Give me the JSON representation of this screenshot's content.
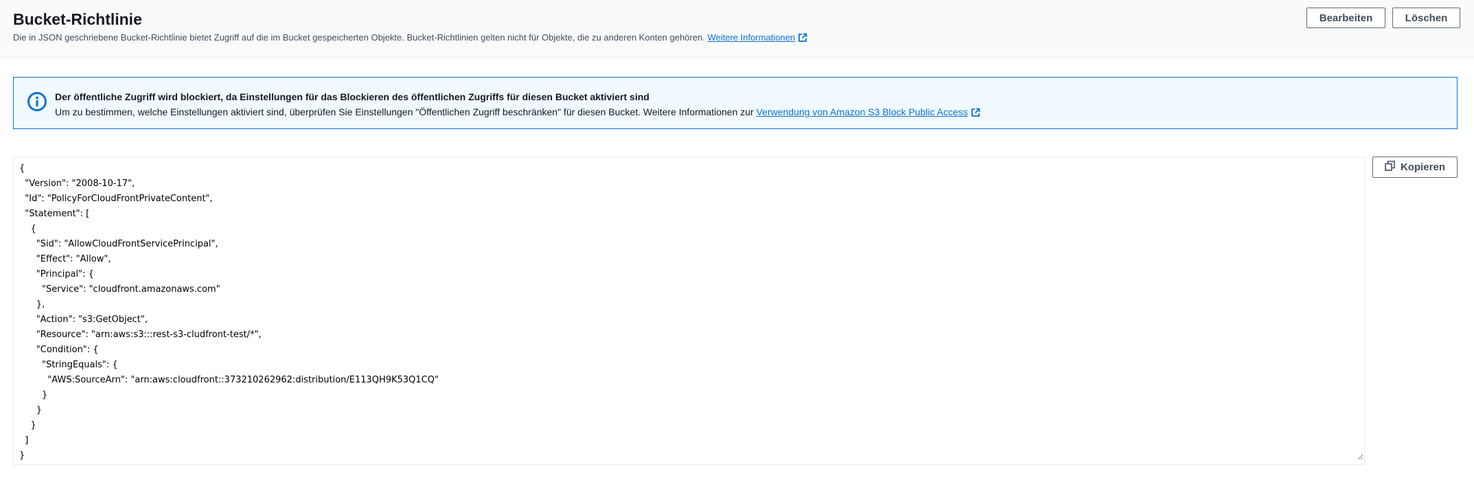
{
  "header": {
    "title": "Bucket-Richtlinie",
    "description": "Die in JSON geschriebene Bucket-Richtlinie bietet Zugriff auf die im Bucket gespeicherten Objekte. Bucket-Richtlinien gelten nicht für Objekte, die zu anderen Konten gehören.",
    "learn_more_label": "Weitere Informationen",
    "edit_label": "Bearbeiten",
    "delete_label": "Löschen"
  },
  "alert": {
    "title": "Der öffentliche Zugriff wird blockiert, da Einstellungen für das Blockieren des öffentlichen Zugriffs für diesen Bucket aktiviert sind",
    "body": "Um zu bestimmen, welche Einstellungen aktiviert sind, überprüfen Sie Einstellungen \"Öffentlichen Zugriff beschränken\" für diesen Bucket. Weitere Informationen zur",
    "link_label": "Verwendung von Amazon S3 Block Public Access",
    "icons": [
      "info-icon",
      "external-link-icon"
    ]
  },
  "policy": {
    "code": "{\n  \"Version\": \"2008-10-17\",\n  \"Id\": \"PolicyForCloudFrontPrivateContent\",\n  \"Statement\": [\n    {\n      \"Sid\": \"AllowCloudFrontServicePrincipal\",\n      \"Effect\": \"Allow\",\n      \"Principal\": {\n        \"Service\": \"cloudfront.amazonaws.com\"\n      },\n      \"Action\": \"s3:GetObject\",\n      \"Resource\": \"arn:aws:s3:::rest-s3-cludfront-test/*\",\n      \"Condition\": {\n        \"StringEquals\": {\n          \"AWS:SourceArn\": \"arn:aws:cloudfront::373210262962:distribution/E113QH9K53Q1CQ\"\n        }\n      }\n    }\n  ]\n}",
    "copy_label": "Kopieren",
    "copy_icon": "copy-icon"
  },
  "colors": {
    "link": "#0972d3",
    "alert_background": "#f1faff",
    "alert_border": "#0972d3",
    "button_border": "#5f6b7a"
  }
}
